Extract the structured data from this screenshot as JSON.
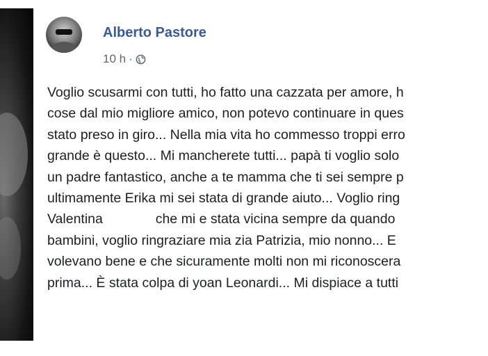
{
  "post": {
    "author": "Alberto Pastore",
    "timestamp": "10 h",
    "separator": "·",
    "privacy_icon": "globe-icon",
    "lines": [
      "Voglio scusarmi con tutti, ho fatto una cazzata per amore, h",
      "cose dal mio migliore amico, non potevo continuare in ques",
      "stato preso in giro... Nella mia vita ho commesso troppi erro",
      "grande è questo... Mi mancherete tutti... papà ti voglio solo",
      "un padre fantastico, anche a te mamma che ti sei sempre p",
      "ultimamente Erika mi sei stata di grande aiuto... Voglio ring",
      "Valentina              che mi e stata vicina sempre da quando",
      "bambini, voglio ringraziare mia zia Patrizia, mio nonno... E",
      "volevano bene e che sicuramente molti non mi riconoscera",
      "prima... È stata colpa di yoan Leonardi... Mi dispiace a tutti"
    ]
  },
  "colors": {
    "author_link": "#3b5998",
    "meta_text": "#606770",
    "body_text": "#1c1e21"
  }
}
